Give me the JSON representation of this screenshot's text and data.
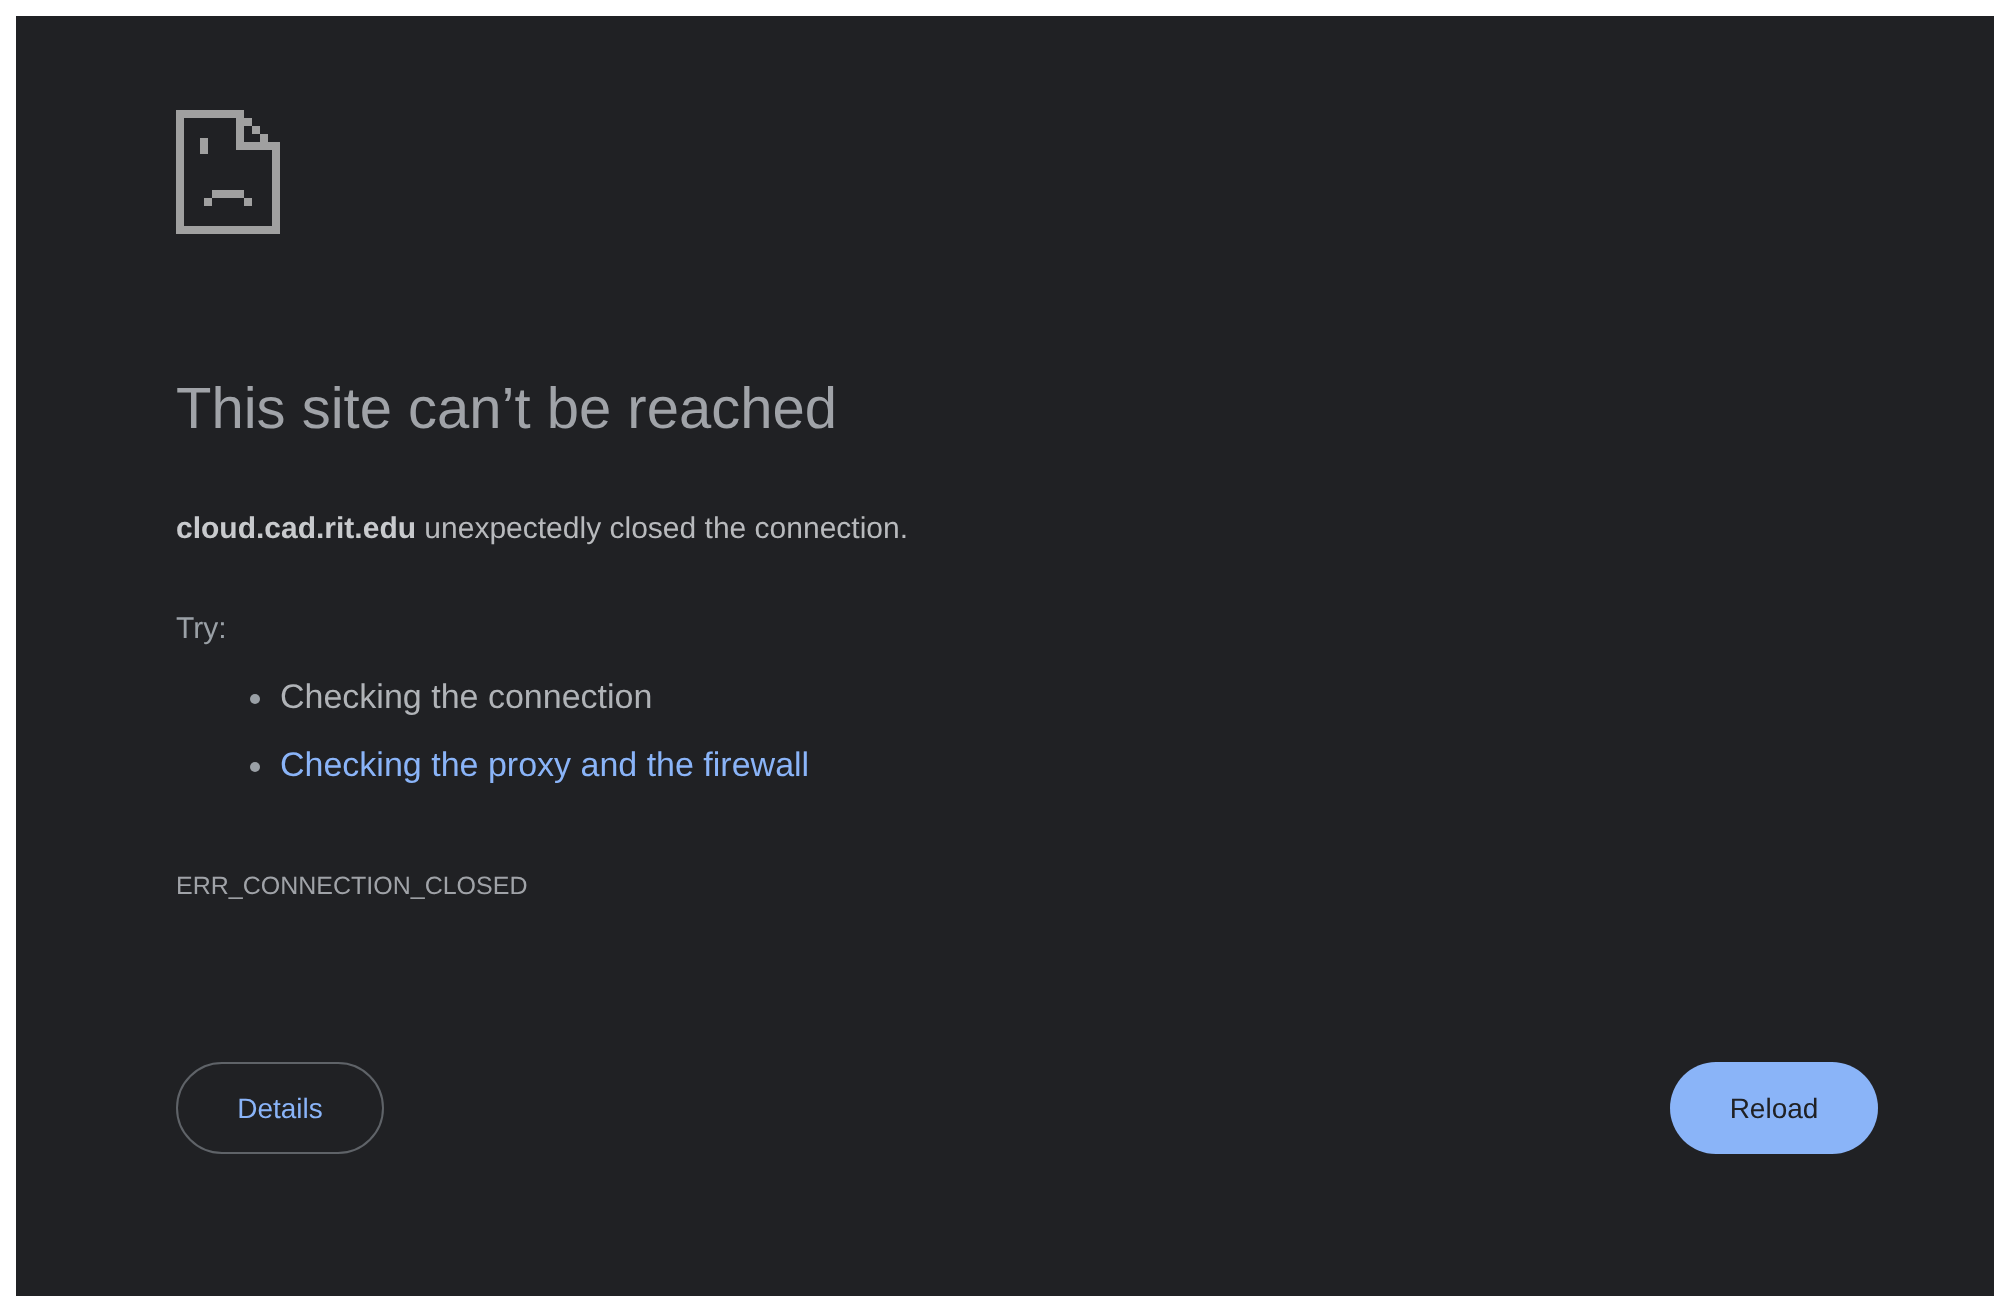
{
  "error_page": {
    "heading": "This site can’t be reached",
    "summary": "**cloud.cad.rit.edu** unexpectedly closed the connection.",
    "suggestions_label": "Try:",
    "suggestions": [
      {
        "kind": "text",
        "label": "Checking the connection"
      },
      {
        "kind": "link",
        "label": "Checking the proxy and the firewall"
      }
    ],
    "error_code": "ERR_CONNECTION_CLOSED",
    "buttons": [
      {
        "kind": "outline",
        "label": "Details"
      },
      {
        "kind": "primary",
        "label": "Reload"
      }
    ]
  }
}
